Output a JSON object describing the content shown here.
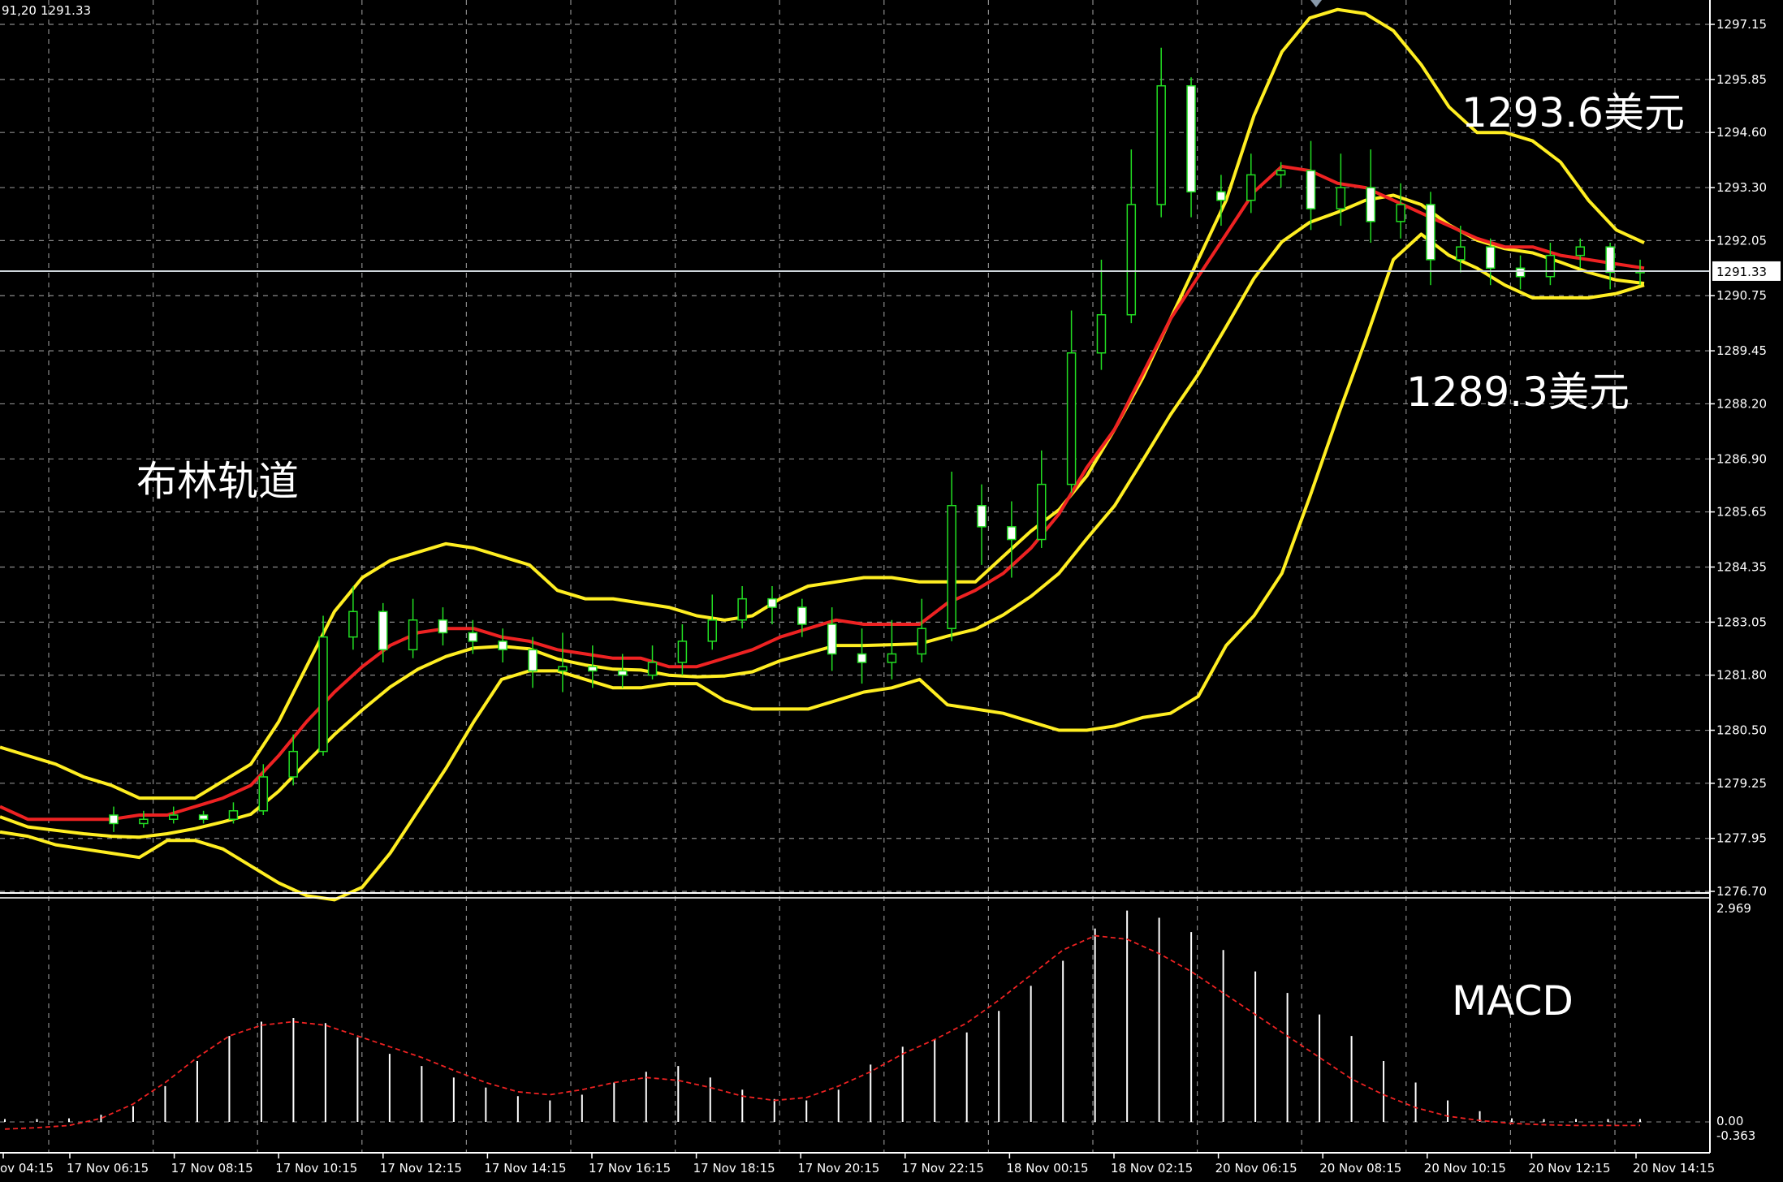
{
  "header": {
    "time": "91,20",
    "price": "1291.33"
  },
  "price_labels": [
    "1297.15",
    "1295.85",
    "1294.60",
    "1293.30",
    "1292.05",
    "1290.75",
    "1289.45",
    "1288.20",
    "1286.90",
    "1285.65",
    "1284.35",
    "1283.05",
    "1281.80",
    "1280.50",
    "1279.25",
    "1277.95",
    "1276.70"
  ],
  "current_price_tag": "1291.33",
  "macd_labels": {
    "top": "2.969",
    "zero": "0.00",
    "bottom": "-0.363"
  },
  "time_labels": [
    "ov 04:15",
    "17 Nov 06:15",
    "17 Nov 08:15",
    "17 Nov 10:15",
    "17 Nov 12:15",
    "17 Nov 14:15",
    "17 Nov 16:15",
    "17 Nov 18:15",
    "17 Nov 20:15",
    "17 Nov 22:15",
    "18 Nov 00:15",
    "18 Nov 02:15",
    "20 Nov 06:15",
    "20 Nov 08:15",
    "20 Nov 10:15",
    "20 Nov 12:15",
    "20 Nov 14:15"
  ],
  "annotations": {
    "bollinger": "布林轨道",
    "upper_value": "1293.6美元",
    "lower_value": "1289.3美元",
    "macd": "MACD"
  },
  "colors": {
    "background": "#000000",
    "grid": "#8a8a8a",
    "candle": "#22dd22",
    "bollinger_band": "#ffee22",
    "moving_average": "#ee2222",
    "macd_histogram": "#ffffff",
    "macd_signal": "#ee2222"
  },
  "chart_data": {
    "type": "candlestick",
    "indicators": [
      "Bollinger Bands",
      "MACD"
    ],
    "price_ylim": [
      1276.7,
      1297.5
    ],
    "macd_ylim": [
      -0.363,
      2.969
    ],
    "grid": true,
    "upper_band": [
      1280.1,
      1279.9,
      1279.7,
      1279.4,
      1279.2,
      1278.9,
      1278.9,
      1278.9,
      1279.3,
      1279.7,
      1280.7,
      1282.0,
      1283.3,
      1284.1,
      1284.5,
      1284.7,
      1284.9,
      1284.8,
      1284.6,
      1284.4,
      1283.8,
      1283.6,
      1283.6,
      1283.5,
      1283.4,
      1283.2,
      1283.1,
      1283.2,
      1283.6,
      1283.9,
      1284.0,
      1284.1,
      1284.1,
      1284.0,
      1284.0,
      1284.0,
      1284.6,
      1285.2,
      1285.7,
      1286.5,
      1287.6,
      1288.8,
      1290.2,
      1291.6,
      1293.0,
      1295.0,
      1296.5,
      1297.3,
      1297.5,
      1297.4,
      1297.0,
      1296.2,
      1295.2,
      1294.6,
      1294.6,
      1294.4,
      1293.9,
      1293.0,
      1292.3,
      1292.0
    ],
    "lower_band": [
      1278.1,
      1278.0,
      1277.8,
      1277.7,
      1277.6,
      1277.5,
      1277.9,
      1277.9,
      1277.7,
      1277.3,
      1276.9,
      1276.6,
      1276.5,
      1276.8,
      1277.6,
      1278.6,
      1279.6,
      1280.7,
      1281.7,
      1281.9,
      1281.9,
      1281.7,
      1281.5,
      1281.5,
      1281.6,
      1281.6,
      1281.2,
      1281.0,
      1281.0,
      1281.0,
      1281.2,
      1281.4,
      1281.5,
      1281.7,
      1281.1,
      1281.0,
      1280.9,
      1280.7,
      1280.5,
      1280.5,
      1280.6,
      1280.8,
      1280.9,
      1281.3,
      1282.5,
      1283.2,
      1284.2,
      1286.0,
      1287.9,
      1289.7,
      1291.6,
      1292.2,
      1291.7,
      1291.4,
      1291.0,
      1290.7,
      1290.7,
      1290.7,
      1290.8,
      1291.0
    ],
    "moving_average": [
      1278.7,
      1278.4,
      1278.4,
      1278.4,
      1278.4,
      1278.5,
      1278.5,
      1278.7,
      1278.9,
      1279.2,
      1279.9,
      1280.7,
      1281.4,
      1282.0,
      1282.5,
      1282.8,
      1282.9,
      1282.9,
      1282.7,
      1282.6,
      1282.4,
      1282.3,
      1282.2,
      1282.2,
      1282.0,
      1282.0,
      1282.2,
      1282.4,
      1282.7,
      1282.9,
      1283.1,
      1283.0,
      1283.0,
      1283.0,
      1283.5,
      1283.8,
      1284.2,
      1284.8,
      1285.6,
      1286.7,
      1287.6,
      1288.9,
      1290.2,
      1291.2,
      1292.2,
      1293.2,
      1293.8,
      1293.7,
      1293.4,
      1293.3,
      1293.0,
      1292.7,
      1292.4,
      1292.1,
      1291.9,
      1291.9,
      1291.7,
      1291.6,
      1291.5,
      1291.4
    ],
    "candles": [
      [
        1278.5,
        1278.3,
        1278.7,
        1278.1
      ],
      [
        1278.3,
        1278.4,
        1278.6,
        1278.2
      ],
      [
        1278.4,
        1278.5,
        1278.7,
        1278.3
      ],
      [
        1278.5,
        1278.4,
        1278.6,
        1278.3
      ],
      [
        1278.4,
        1278.6,
        1278.8,
        1278.3
      ],
      [
        1278.6,
        1279.4,
        1279.7,
        1278.5
      ],
      [
        1279.4,
        1280.0,
        1280.4,
        1279.2
      ],
      [
        1280.0,
        1282.7,
        1283.2,
        1279.9
      ],
      [
        1282.7,
        1283.3,
        1283.9,
        1282.4
      ],
      [
        1283.3,
        1282.4,
        1283.5,
        1282.1
      ],
      [
        1282.4,
        1283.1,
        1283.6,
        1282.2
      ],
      [
        1283.1,
        1282.8,
        1283.4,
        1282.5
      ],
      [
        1282.8,
        1282.6,
        1283.1,
        1282.3
      ],
      [
        1282.6,
        1282.4,
        1282.9,
        1282.1
      ],
      [
        1282.4,
        1281.9,
        1282.7,
        1281.5
      ],
      [
        1281.9,
        1282.0,
        1282.8,
        1281.4
      ],
      [
        1282.0,
        1281.9,
        1282.5,
        1281.5
      ],
      [
        1281.9,
        1281.8,
        1282.3,
        1281.5
      ],
      [
        1281.8,
        1282.1,
        1282.5,
        1281.7
      ],
      [
        1282.1,
        1282.6,
        1283.0,
        1281.8
      ],
      [
        1282.6,
        1283.1,
        1283.7,
        1282.4
      ],
      [
        1283.1,
        1283.6,
        1283.9,
        1282.9
      ],
      [
        1283.6,
        1283.4,
        1283.9,
        1283.0
      ],
      [
        1283.4,
        1283.0,
        1283.6,
        1282.7
      ],
      [
        1283.0,
        1282.3,
        1283.4,
        1281.9
      ],
      [
        1282.3,
        1282.1,
        1282.9,
        1281.6
      ],
      [
        1282.1,
        1282.3,
        1283.1,
        1281.7
      ],
      [
        1282.3,
        1282.9,
        1283.6,
        1282.1
      ],
      [
        1282.9,
        1285.8,
        1286.6,
        1282.6
      ],
      [
        1285.8,
        1285.3,
        1286.3,
        1284.4
      ],
      [
        1285.3,
        1285.0,
        1285.9,
        1284.1
      ],
      [
        1285.0,
        1286.3,
        1287.1,
        1284.8
      ],
      [
        1286.3,
        1289.4,
        1290.4,
        1286.1
      ],
      [
        1289.4,
        1290.3,
        1291.6,
        1289.0
      ],
      [
        1290.3,
        1292.9,
        1294.2,
        1290.1
      ],
      [
        1292.9,
        1295.7,
        1296.6,
        1292.6
      ],
      [
        1295.7,
        1293.2,
        1295.9,
        1292.6
      ],
      [
        1293.2,
        1293.0,
        1293.6,
        1292.4
      ],
      [
        1293.0,
        1293.6,
        1294.1,
        1292.7
      ],
      [
        1293.6,
        1293.7,
        1293.9,
        1293.3
      ],
      [
        1293.7,
        1292.8,
        1294.4,
        1292.3
      ],
      [
        1292.8,
        1293.3,
        1294.1,
        1292.4
      ],
      [
        1293.3,
        1292.5,
        1294.2,
        1292.0
      ],
      [
        1292.5,
        1292.9,
        1293.4,
        1292.1
      ],
      [
        1292.9,
        1291.6,
        1293.2,
        1291.0
      ],
      [
        1291.6,
        1291.9,
        1292.4,
        1291.3
      ],
      [
        1291.9,
        1291.4,
        1292.1,
        1291.0
      ],
      [
        1291.4,
        1291.2,
        1291.7,
        1290.9
      ],
      [
        1291.2,
        1291.7,
        1292.0,
        1291.0
      ],
      [
        1291.7,
        1291.9,
        1292.1,
        1291.4
      ],
      [
        1291.9,
        1291.3,
        1292.0,
        1290.9
      ],
      [
        1291.3,
        1291.33,
        1291.6,
        1291.0
      ]
    ],
    "macd_histogram": [
      0.0,
      0.02,
      0.05,
      0.1,
      0.22,
      0.5,
      0.85,
      1.2,
      1.4,
      1.45,
      1.38,
      1.18,
      0.95,
      0.78,
      0.62,
      0.48,
      0.36,
      0.3,
      0.38,
      0.55,
      0.7,
      0.78,
      0.62,
      0.45,
      0.32,
      0.3,
      0.45,
      0.8,
      1.05,
      1.15,
      1.25,
      1.55,
      1.9,
      2.25,
      2.7,
      2.95,
      2.85,
      2.65,
      2.4,
      2.1,
      1.8,
      1.5,
      1.2,
      0.85,
      0.55,
      0.3,
      0.15,
      0.05,
      0.0,
      0.0,
      0.0,
      0.0
    ],
    "macd_signal": [
      -0.1,
      -0.08,
      -0.05,
      0.05,
      0.25,
      0.55,
      0.9,
      1.2,
      1.35,
      1.4,
      1.35,
      1.2,
      1.05,
      0.9,
      0.72,
      0.55,
      0.42,
      0.38,
      0.45,
      0.55,
      0.62,
      0.58,
      0.48,
      0.36,
      0.3,
      0.34,
      0.5,
      0.7,
      0.95,
      1.15,
      1.38,
      1.7,
      2.05,
      2.4,
      2.6,
      2.55,
      2.35,
      2.1,
      1.8,
      1.5,
      1.2,
      0.9,
      0.6,
      0.38,
      0.2,
      0.08,
      0.02,
      -0.02,
      -0.04,
      -0.05,
      -0.05,
      -0.05
    ]
  }
}
